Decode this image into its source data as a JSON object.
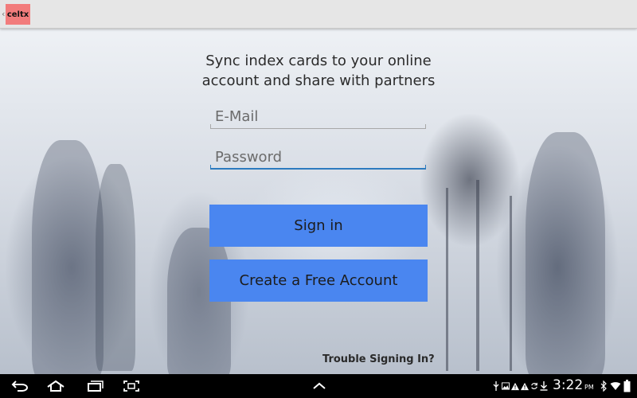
{
  "app": {
    "logo_text": "celtx"
  },
  "login": {
    "headline": "Sync index cards to your online account and share with partners",
    "email_placeholder": "E-Mail",
    "password_placeholder": "Password",
    "signin_label": "Sign in",
    "create_label": "Create a Free Account",
    "trouble_label": "Trouble Signing In?"
  },
  "system_bar": {
    "time": "3:22",
    "ampm": "PM",
    "nav_icons": [
      "back-icon",
      "home-icon",
      "recent-apps-icon",
      "screenshot-icon",
      "expand-up-icon"
    ],
    "status_icons": [
      "usb-icon",
      "image-icon",
      "warning-icon",
      "warning-icon",
      "sync-icon",
      "download-icon"
    ],
    "right_icons": [
      "bluetooth-icon",
      "wifi-icon",
      "battery-icon"
    ]
  },
  "colors": {
    "accent": "#4a86f0",
    "focus_underline": "#2c7bbf",
    "logo_bg": "#f27c7c",
    "action_bar": "#e6e6e6"
  }
}
